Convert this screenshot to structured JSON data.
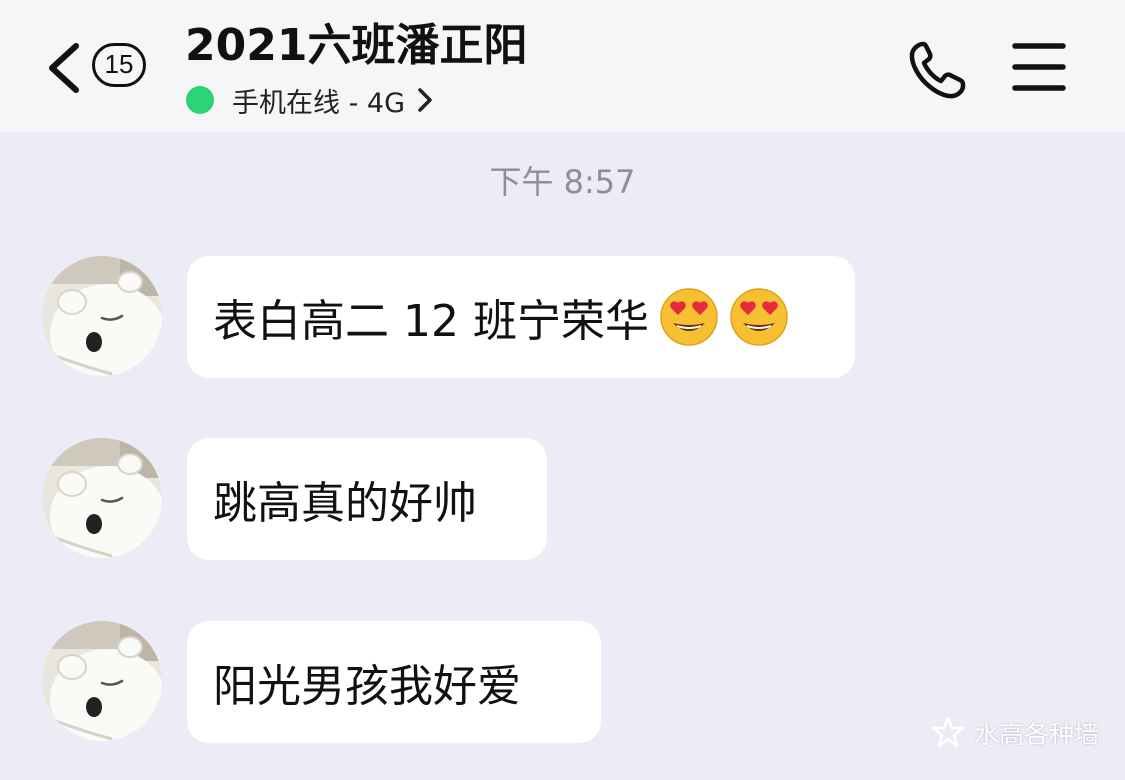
{
  "header": {
    "unread_count": "15",
    "contact_name": "2021六班潘正阳",
    "status_text": "手机在线 - 4G",
    "back_icon": "chevron-left-icon",
    "call_icon": "phone-icon",
    "menu_icon": "hamburger-menu-icon",
    "status_color": "#2bd474"
  },
  "timestamp": "下午 8:57",
  "messages": [
    {
      "text": "表白高二 12 班宁荣华",
      "emoji": [
        "heart-eyes-emoji",
        "heart-eyes-emoji"
      ]
    },
    {
      "text": "跳高真的好帅"
    },
    {
      "text": "阳光男孩我好爱"
    }
  ],
  "avatar": "polar-bear-avatar",
  "watermark": {
    "icon": "star-logo-icon",
    "text": "水高各种墙"
  },
  "colors": {
    "background": "#ececf7",
    "header_bg": "#f6f6f8",
    "bubble_bg": "#ffffff",
    "timestamp": "#8e8e96"
  }
}
